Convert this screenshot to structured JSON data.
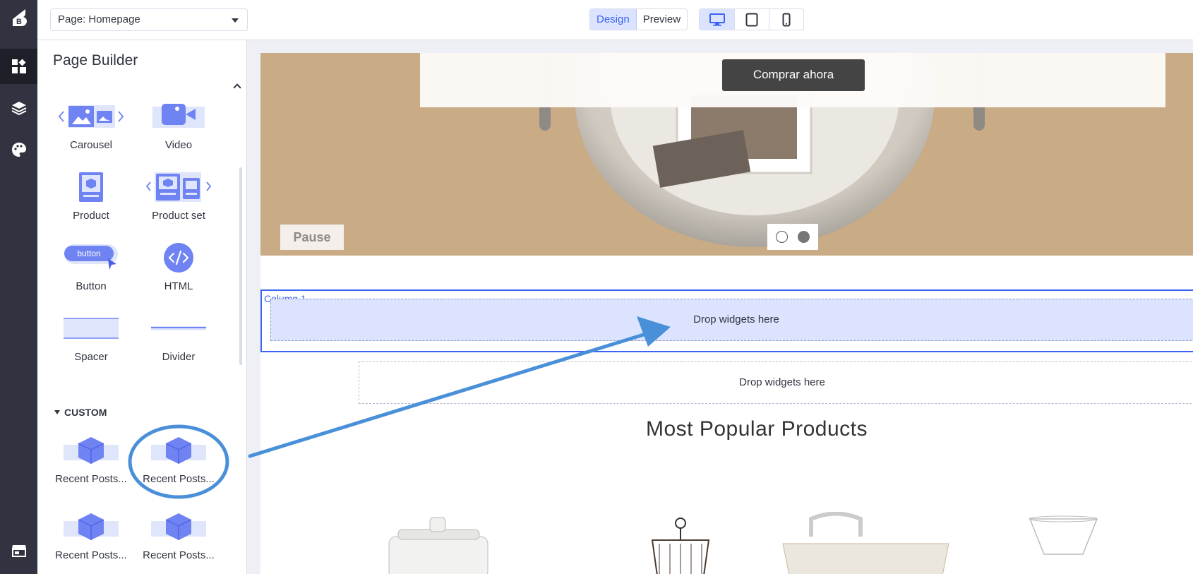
{
  "app": {
    "logo_text": "B"
  },
  "rail": {
    "icons": [
      "bigcommerce-logo-icon",
      "widgets-icon",
      "layers-icon",
      "palette-icon",
      "storefront-icon"
    ]
  },
  "topbar": {
    "page_select": "Page: Homepage",
    "modes": [
      "Design",
      "Preview"
    ],
    "selected_mode": "Design",
    "devices": [
      "desktop-icon",
      "tablet-icon",
      "mobile-icon"
    ],
    "selected_device": "desktop"
  },
  "sidebar": {
    "title": "Page Builder",
    "widgets": [
      {
        "label": "Carousel",
        "icon": "carousel-icon"
      },
      {
        "label": "Video",
        "icon": "video-icon"
      },
      {
        "label": "Product",
        "icon": "product-icon"
      },
      {
        "label": "Product set",
        "icon": "product-set-icon"
      },
      {
        "label": "Button",
        "icon": "button-icon",
        "icon_text": "button"
      },
      {
        "label": "HTML",
        "icon": "html-icon"
      },
      {
        "label": "Spacer",
        "icon": "spacer-icon"
      },
      {
        "label": "Divider",
        "icon": "divider-icon"
      }
    ],
    "custom_header": "CUSTOM",
    "custom_widgets": [
      {
        "label": "Recent Posts..."
      },
      {
        "label": "Recent Posts..."
      },
      {
        "label": "Recent Posts..."
      },
      {
        "label": "Recent Posts..."
      }
    ]
  },
  "canvas": {
    "hero_button": "Comprar ahora",
    "pause_button": "Pause",
    "carousel_slides": 2,
    "carousel_active_slide": 2,
    "column_label": "Column 1",
    "drop_zone_1": "Drop widgets here",
    "drop_zone_2": "Drop widgets here",
    "section_title": "Most Popular Products"
  },
  "colors": {
    "accent": "#3c64f4",
    "annotation": "#4a90d9",
    "rail": "#313440",
    "hero_bg": "#c9ab86"
  }
}
